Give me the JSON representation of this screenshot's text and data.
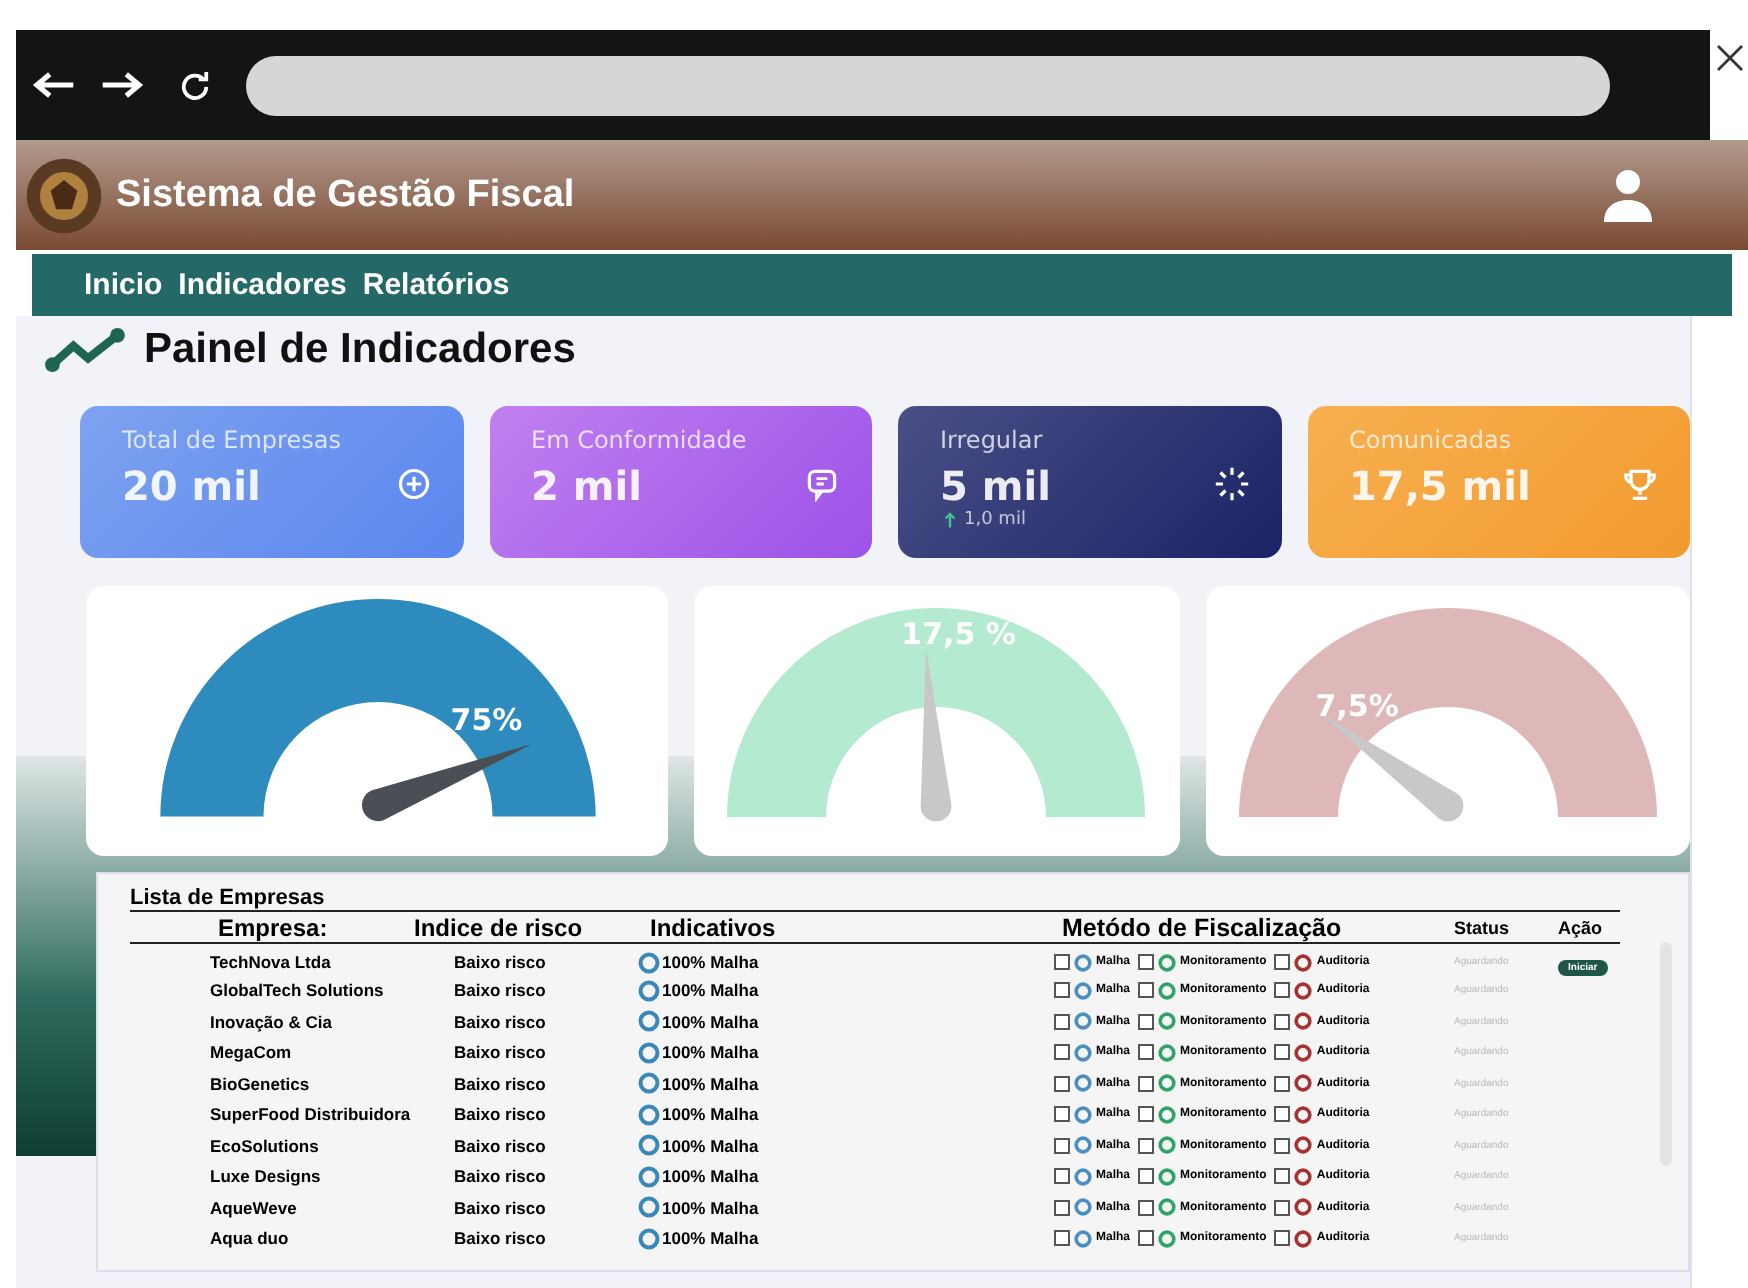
{
  "app": {
    "title": "Sistema de Gestão Fiscal"
  },
  "nav": [
    {
      "label": "Inicio"
    },
    {
      "label": "Indicadores"
    },
    {
      "label": "Relatórios"
    }
  ],
  "page_title": "Painel de Indicadores",
  "cards": [
    {
      "label": "Total de  Empresas",
      "value": "20 mil"
    },
    {
      "label": "Em Conformidade",
      "value": "2 mil"
    },
    {
      "label": "Irregular",
      "value": "5 mil",
      "note": "1,0 mil"
    },
    {
      "label": "Comunicadas",
      "value": "17,5 mil"
    }
  ],
  "gauges": [
    {
      "reading": "75%",
      "color": "#2e8bbd"
    },
    {
      "reading": "17,5 %",
      "color": "#b3ead0"
    },
    {
      "reading": "7,5%",
      "color": "#deb8b8"
    }
  ],
  "table": {
    "title": "Lista de Empresas",
    "columns": [
      "Empresa:",
      "Indice de risco",
      "Indicativos",
      "Metódo de Fiscalização",
      "Status",
      "Ação"
    ],
    "rows": [
      {
        "company": "TechNova Ltda",
        "risk": "Baixo risco",
        "indicator": "100% Malha",
        "methods": [
          {
            "label": "Malha",
            "checked": false,
            "color": "#4a8fc2"
          },
          {
            "label": "Monitoramento",
            "checked": false,
            "color": "#2fa36b"
          },
          {
            "label": "Auditoria",
            "checked": false,
            "color": "#a83232"
          }
        ],
        "status": "Aguardando",
        "action": "Iniciar"
      },
      {
        "company": "GlobalTech Solutions",
        "risk": "Baixo risco",
        "indicator": "100% Malha",
        "methods": [
          {
            "label": "Malha",
            "checked": false,
            "color": "#4a8fc2"
          },
          {
            "label": "Monitoramento",
            "checked": false,
            "color": "#2fa36b"
          },
          {
            "label": "Auditoria",
            "checked": false,
            "color": "#a83232"
          }
        ],
        "status": "Aguardando"
      },
      {
        "company": "Inovação & Cia",
        "risk": "Baixo risco",
        "indicator": "100% Malha",
        "methods": [
          {
            "label": "Malha",
            "checked": false,
            "color": "#4a8fc2"
          },
          {
            "label": "Monitoramento",
            "checked": false,
            "color": "#2fa36b"
          },
          {
            "label": "Auditoria",
            "checked": false,
            "color": "#a83232"
          }
        ],
        "status": "Aguardando"
      },
      {
        "company": "MegaCom",
        "risk": "Baixo risco",
        "indicator": "100% Malha",
        "methods": [
          {
            "label": "Malha",
            "checked": false,
            "color": "#4a8fc2"
          },
          {
            "label": "Monitoramento",
            "checked": false,
            "color": "#2fa36b"
          },
          {
            "label": "Auditoria",
            "checked": false,
            "color": "#a83232"
          }
        ],
        "status": "Aguardando"
      },
      {
        "company": "BioGenetics",
        "risk": "Baixo risco",
        "indicator": "100% Malha",
        "methods": [
          {
            "label": "Malha",
            "checked": false,
            "color": "#4a8fc2"
          },
          {
            "label": "Monitoramento",
            "checked": false,
            "color": "#2fa36b"
          },
          {
            "label": "Auditoria",
            "checked": false,
            "color": "#a83232"
          }
        ],
        "status": "Aguardando"
      },
      {
        "company": "SuperFood Distribuidora",
        "risk": "Baixo risco",
        "indicator": "100% Malha",
        "methods": [
          {
            "label": "Malha",
            "checked": false,
            "color": "#4a8fc2"
          },
          {
            "label": "Monitoramento",
            "checked": false,
            "color": "#2fa36b"
          },
          {
            "label": "Auditoria",
            "checked": false,
            "color": "#a83232"
          }
        ],
        "status": "Aguardando"
      },
      {
        "company": "EcoSolutions",
        "risk": "Baixo risco",
        "indicator": "100% Malha",
        "methods": [
          {
            "label": "Malha",
            "checked": false,
            "color": "#4a8fc2"
          },
          {
            "label": "Monitoramento",
            "checked": false,
            "color": "#2fa36b"
          },
          {
            "label": "Auditoria",
            "checked": false,
            "color": "#a83232"
          }
        ],
        "status": "Aguardando"
      },
      {
        "company": "Luxe Designs",
        "risk": "Baixo risco",
        "indicator": "100% Malha",
        "methods": [
          {
            "label": "Malha",
            "checked": false,
            "color": "#4a8fc2"
          },
          {
            "label": "Monitoramento",
            "checked": false,
            "color": "#2fa36b"
          },
          {
            "label": "Auditoria",
            "checked": false,
            "color": "#a83232"
          }
        ],
        "status": "Aguardando"
      },
      {
        "company": "AqueWeve",
        "risk": "Baixo risco",
        "indicator": "100% Malha",
        "methods": [
          {
            "label": "Malha",
            "checked": false,
            "color": "#4a8fc2"
          },
          {
            "label": "Monitoramento",
            "checked": false,
            "color": "#2fa36b"
          },
          {
            "label": "Auditoria",
            "checked": false,
            "color": "#a83232"
          }
        ],
        "status": "Aguardando"
      },
      {
        "company": "Aqua duo",
        "risk": "Baixo risco",
        "indicator": "100% Malha",
        "methods": [
          {
            "label": "Malha",
            "checked": false,
            "color": "#4a8fc2"
          },
          {
            "label": "Monitoramento",
            "checked": false,
            "color": "#2fa36b"
          },
          {
            "label": "Auditoria",
            "checked": false,
            "color": "#a83232"
          }
        ],
        "status": "Aguardando"
      }
    ]
  }
}
